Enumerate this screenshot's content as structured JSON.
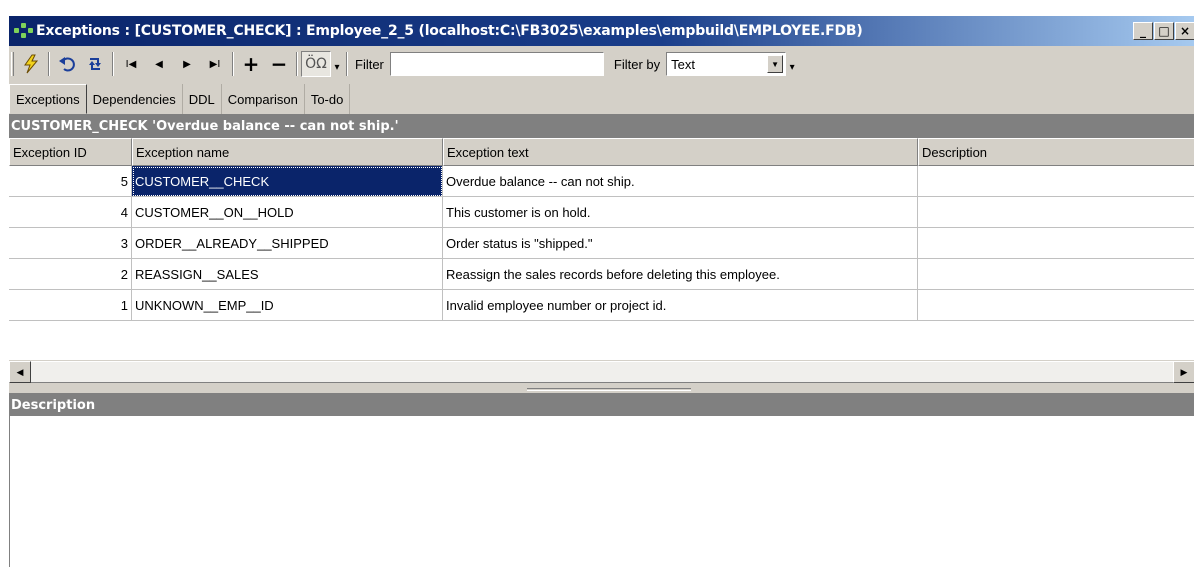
{
  "window": {
    "title": "Exceptions : [CUSTOMER_CHECK] : Employee_2_5 (localhost:C:\\FB3025\\examples\\empbuild\\EMPLOYEE.FDB)",
    "buttons": {
      "minimize": "_",
      "maximize": "□",
      "close": "×"
    }
  },
  "toolbar": {
    "icons": [
      "lightning-icon",
      "undo-icon",
      "refresh-icon",
      "first-icon",
      "prev-icon",
      "next-icon",
      "last-icon",
      "add-icon",
      "delete-icon",
      "charset-icon"
    ],
    "first_glyph": "I◀",
    "prev_glyph": "◀",
    "next_glyph": "▶",
    "last_glyph": "▶I",
    "add_glyph": "+",
    "delete_glyph": "−",
    "charset_glyph": "ÖΩ",
    "filter_label": "Filter",
    "filter_value": "",
    "filter_by_label": "Filter by",
    "filter_by_value": "Text"
  },
  "tabs": [
    {
      "label": "Exceptions",
      "active": true
    },
    {
      "label": "Dependencies",
      "active": false
    },
    {
      "label": "DDL",
      "active": false
    },
    {
      "label": "Comparison",
      "active": false
    },
    {
      "label": "To-do",
      "active": false
    }
  ],
  "header_bar": "CUSTOMER_CHECK 'Overdue balance -- can not ship.'",
  "grid": {
    "columns": [
      "Exception ID",
      "Exception name",
      "Exception text",
      "Description"
    ],
    "rows": [
      {
        "id": "5",
        "name": "CUSTOMER__CHECK",
        "text": "Overdue balance -- can not ship.",
        "description": ""
      },
      {
        "id": "4",
        "name": "CUSTOMER__ON__HOLD",
        "text": "This customer is on hold.",
        "description": ""
      },
      {
        "id": "3",
        "name": "ORDER__ALREADY__SHIPPED",
        "text": "Order status is \"shipped.\"",
        "description": ""
      },
      {
        "id": "2",
        "name": "REASSIGN__SALES",
        "text": "Reassign the sales records before deleting this employee.",
        "description": ""
      },
      {
        "id": "1",
        "name": "UNKNOWN__EMP__ID",
        "text": "Invalid employee number or project id.",
        "description": ""
      }
    ]
  },
  "description_bar": "Description",
  "colors": {
    "titlebar": "#0a246a",
    "selection": "#0a246a",
    "header_bar": "#808080",
    "face": "#d4d0c8"
  }
}
